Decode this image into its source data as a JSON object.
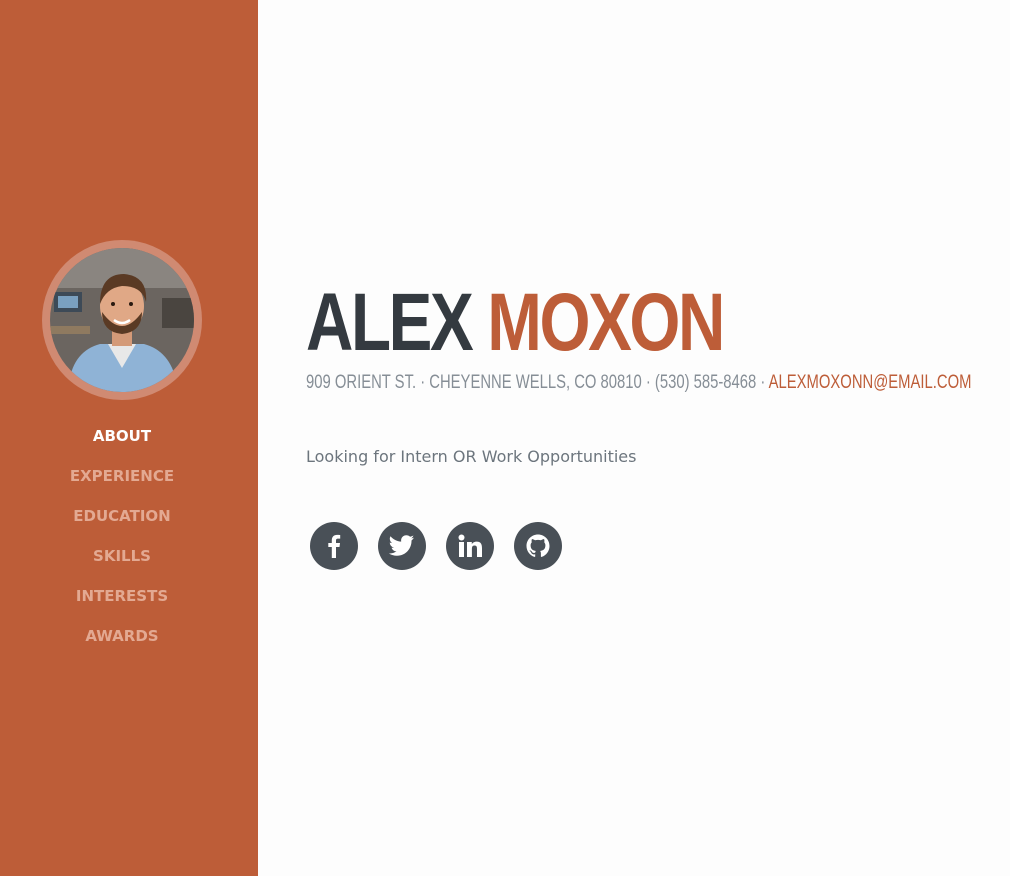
{
  "sidebar": {
    "accent": "#bd5d38",
    "avatar": {
      "alt": "profile-photo"
    },
    "nav": [
      {
        "label": "ABOUT",
        "active": true
      },
      {
        "label": "EXPERIENCE",
        "active": false
      },
      {
        "label": "EDUCATION",
        "active": false
      },
      {
        "label": "SKILLS",
        "active": false
      },
      {
        "label": "INTERESTS",
        "active": false
      },
      {
        "label": "AWARDS",
        "active": false
      }
    ]
  },
  "about": {
    "first_name": "ALEX",
    "last_name": "MOXON",
    "address": "909 ORIENT ST. · CHEYENNE WELLS, CO 80810 · (530) 585-8468 · ",
    "email": "ALEXMOXONN@EMAIL.COM",
    "lead": "Looking for Intern OR Work Opportunities",
    "social": [
      {
        "icon": "facebook-icon"
      },
      {
        "icon": "twitter-icon"
      },
      {
        "icon": "linkedin-icon"
      },
      {
        "icon": "github-icon"
      }
    ]
  },
  "colors": {
    "dark_text": "#343a40",
    "muted_text": "#868e96",
    "icon_bg": "#495057"
  }
}
